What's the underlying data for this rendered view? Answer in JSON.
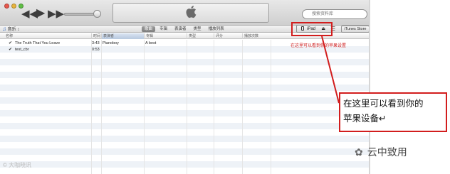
{
  "toolbar": {
    "search_placeholder": "搜索资料库",
    "transport": {
      "prev": "◀◀",
      "play": "▶",
      "next": "▶▶"
    },
    "apple_logo": "apple-logo"
  },
  "nav": {
    "source": "音乐",
    "tabs": [
      {
        "label": "歌曲",
        "selected": true
      },
      {
        "label": "专辑",
        "selected": false
      },
      {
        "label": "表演者",
        "selected": false
      },
      {
        "label": "类型",
        "selected": false
      },
      {
        "label": "播放列表",
        "selected": false
      }
    ],
    "device": "iPad",
    "store": "iTunes Store"
  },
  "table": {
    "columns": [
      "名称",
      "时间",
      "表演者",
      "专辑",
      "类型",
      "评分",
      "播放次数"
    ],
    "rows": [
      {
        "checked": "✔",
        "name": "The Truth That You Leave",
        "time": "3:43",
        "artist": "Pianoboy",
        "album": "A best"
      },
      {
        "checked": "✔",
        "name": "test_cbr",
        "time": "0:53",
        "artist": "",
        "album": ""
      }
    ]
  },
  "annotation": {
    "small_note": "在这里可以看到你的苹果设置",
    "callout_line1": "在这里可以看到你的",
    "callout_line2": "苹果设备↵",
    "color": "#d21d1d"
  },
  "watermarks": {
    "left": "© 大咖晓讯",
    "right": "云中致用"
  },
  "colors": {
    "accent": "#d21d1d",
    "tab_selected": "#8a8a8a"
  }
}
